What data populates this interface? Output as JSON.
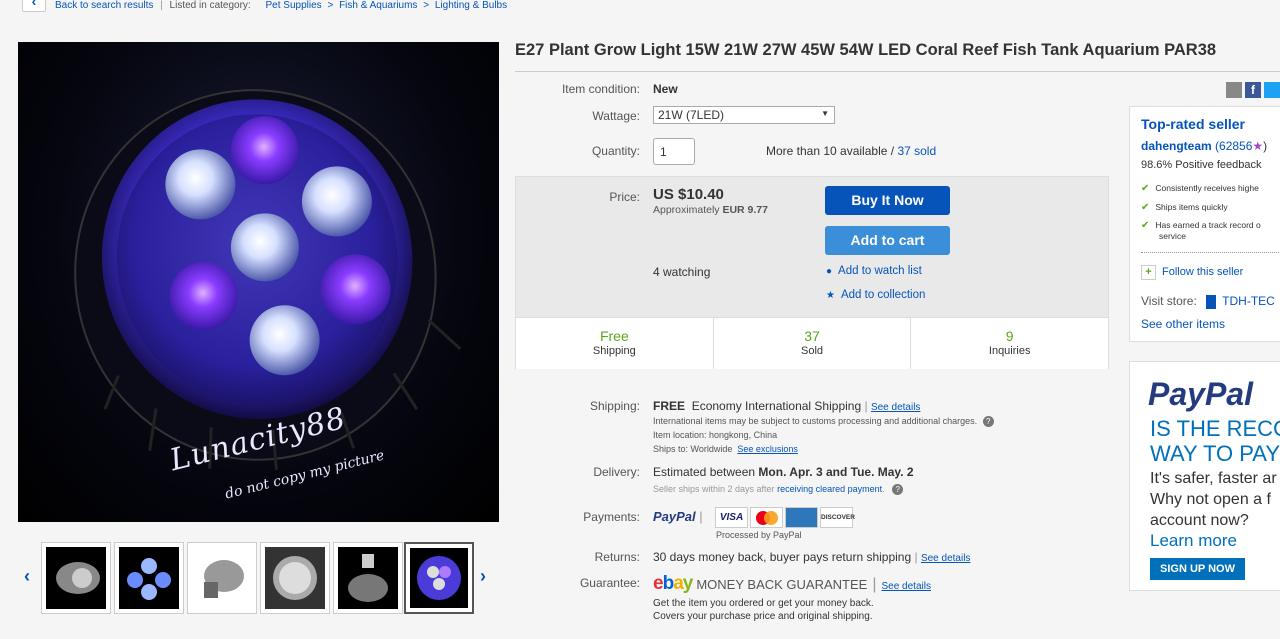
{
  "breadcrumb": {
    "back": "Back to search results",
    "listed": "Listed in category:",
    "cats": [
      "Pet Supplies",
      ">",
      "Fish & Aquariums",
      ">",
      "Lighting & Bulbs"
    ]
  },
  "image": {
    "watermark1": "Lunacity88",
    "watermark2": "do not copy my picture"
  },
  "title": "E27 Plant Grow Light 15W 21W 27W 45W 54W LED Coral Reef Fish Tank Aquarium PAR38",
  "item": {
    "condition_label": "Item condition:",
    "condition_value": "New",
    "wattage_label": "Wattage:",
    "wattage_value": "21W (7LED)",
    "quantity_label": "Quantity:",
    "quantity_value": "1",
    "availability": "More than 10 available /",
    "sold_link": "37 sold"
  },
  "price": {
    "label": "Price:",
    "value": "US $10.40",
    "approx": "Approximately",
    "approx_value": "EUR 9.77",
    "watching": "4 watching",
    "buy_now": "Buy It Now",
    "add_to_cart": "Add to cart",
    "watch_list": "Add to watch list",
    "collection": "Add to collection"
  },
  "stats": [
    {
      "n": "Free",
      "t": "Shipping"
    },
    {
      "n": "37",
      "t": "Sold"
    },
    {
      "n": "9",
      "t": "Inquiries"
    }
  ],
  "shipping": {
    "label": "Shipping:",
    "free": "FREE",
    "method": "Economy International Shipping",
    "see_details": "See details",
    "intl_note": "International items may be subject to customs processing and additional charges.",
    "location": "Item location:  hongkong, China",
    "ships_to": "Ships to:  Worldwide",
    "exclusions": "See exclusions"
  },
  "delivery": {
    "label": "Delivery:",
    "text": "Estimated between",
    "dates": "Mon. Apr. 3 and Tue. May. 2",
    "note": "Seller ships within 2 days after",
    "note_link": "receiving cleared payment",
    "note_end": "."
  },
  "payments": {
    "label": "Payments:",
    "paypal": "PayPal",
    "processed": "Processed by PayPal"
  },
  "returns": {
    "label": "Returns:",
    "text": "30 days money back, buyer pays return shipping",
    "see_details": "See details"
  },
  "guarantee": {
    "label": "Guarantee:",
    "mbg": "MONEY BACK GUARANTEE",
    "see_details": "See details",
    "line1": "Get the item you ordered or get your money back.",
    "line2": "Covers your purchase price and original shipping."
  },
  "seller": {
    "top_rated": "Top-rated seller",
    "name": "dahengteam",
    "score": "(62856",
    "score_end": ")",
    "feedback": "98.6% Positive feedback",
    "checks": [
      "Consistently receives highe",
      "Ships items quickly",
      "Has earned a track record o",
      "service"
    ],
    "follow": "Follow this seller",
    "visit": "Visit store:",
    "store": "TDH-TEC",
    "other": "See other items"
  },
  "paypal_ad": {
    "logo": "PayPal",
    "h1": "IS THE RECO",
    "h2": "WAY TO PAY",
    "b1": "It's safer, faster ar",
    "b2": "Why not open a f",
    "b3": "account now?",
    "learn": "Learn more",
    "signup": "SIGN UP NOW"
  },
  "colors": {
    "link": "#0654ba",
    "buy": "#0654ba",
    "cart": "#3b8fd8",
    "green": "#5ba71b"
  }
}
